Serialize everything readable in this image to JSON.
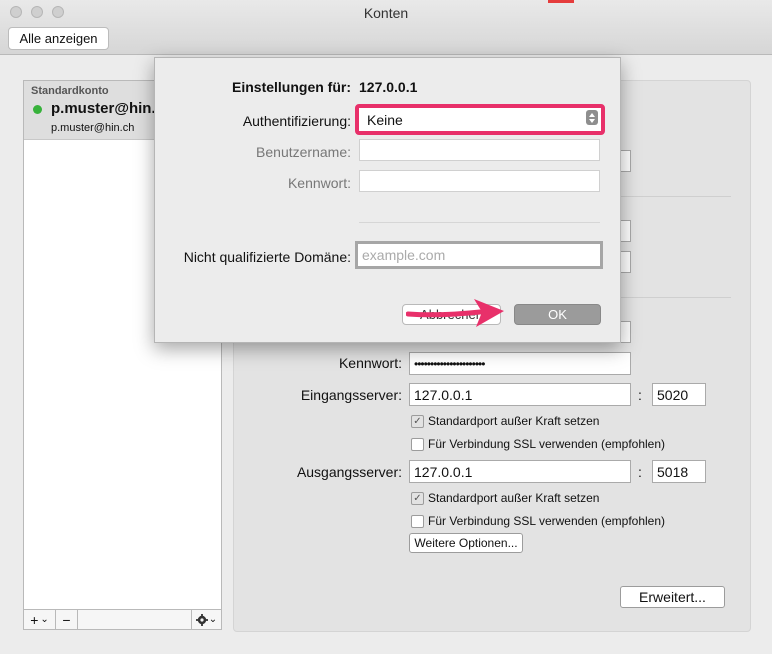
{
  "window": {
    "title": "Konten",
    "show_all_button": "Alle anzeigen"
  },
  "accounts": {
    "section_label": "Standardkonto",
    "items": [
      {
        "name": "p.muster@hin.c",
        "email": "p.muster@hin.ch",
        "status_color": "#37b23b"
      }
    ],
    "add_label": "+",
    "add_chevron": "⌄",
    "remove_label": "−",
    "gear_chevron": "⌄"
  },
  "settings": {
    "password_label": "Kennwort:",
    "password_value": "••••••••••••••••••••••",
    "incoming_label": "Eingangsserver:",
    "incoming_server": "127.0.0.1",
    "incoming_port": "5020",
    "port_colon": ":",
    "incoming_override_label": "Standardport außer Kraft setzen",
    "incoming_override_checked": true,
    "incoming_ssl_label": "Für Verbindung SSL verwenden (empfohlen)",
    "incoming_ssl_checked": false,
    "outgoing_label": "Ausgangsserver:",
    "outgoing_server": "127.0.0.1",
    "outgoing_port": "5018",
    "outgoing_override_label": "Standardport außer Kraft setzen",
    "outgoing_override_checked": true,
    "outgoing_ssl_label": "Für Verbindung SSL verwenden (empfohlen)",
    "outgoing_ssl_checked": false,
    "more_options_button": "Weitere Optionen...",
    "advanced_button": "Erweitert..."
  },
  "dialog": {
    "settings_for_label": "Einstellungen für:",
    "settings_for_value": "127.0.0.1",
    "auth_label": "Authentifizierung:",
    "auth_value": "Keine",
    "username_label": "Benutzername:",
    "password_label": "Kennwort:",
    "domain_label": "Nicht qualifizierte Domäne:",
    "domain_placeholder": "example.com",
    "cancel_button": "Abbrechen",
    "ok_button": "OK",
    "check_mark": "✓"
  },
  "colors": {
    "highlight": "#e8306a",
    "arrow": "#e8306a",
    "ok_button": "#9b9b9b",
    "status_online": "#37b23b"
  }
}
